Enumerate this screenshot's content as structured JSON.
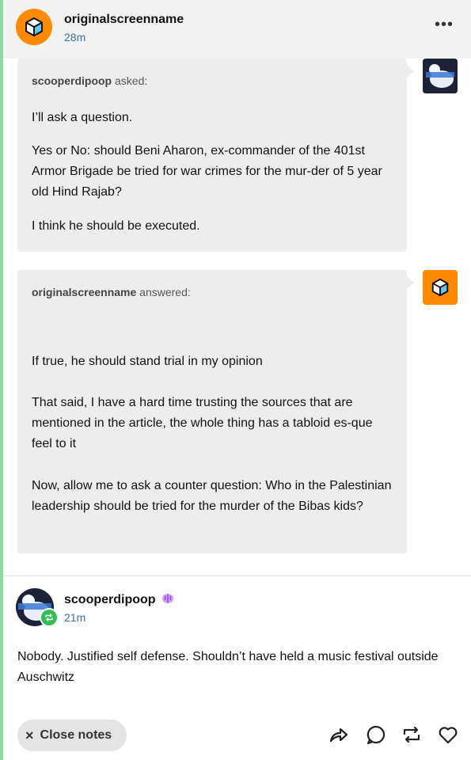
{
  "header": {
    "blog_name": "originalscreenname",
    "time": "28m",
    "more_menu": "•••"
  },
  "ask": {
    "asker": "scooperdipoop",
    "verb": " asked:",
    "paragraphs": [
      "I’ll ask a question.",
      "Yes or No: should Beni Aharon, ex-commander of the 401st Armor Brigade be tried for war crimes for the mur-der of 5 year old Hind Rajab?",
      "I think he should be executed."
    ]
  },
  "answer": {
    "answerer": "originalscreenname",
    "verb": " answered:",
    "paragraphs": [
      "If true, he should stand trial in my opinion",
      "That said, I have a hard time trusting the sources that are mentioned in the article, the whole thing has a tabloid es-que feel to it",
      "Now, allow me to ask a counter question: Who in the Palestinian leadership should be tried for the murder of the Bibas kids?"
    ]
  },
  "reply": {
    "blog_name": "scooperdipoop",
    "time": "21m",
    "text": "Nobody. Justified self defense. Shouldn’t have held a music festival outside Auschwitz"
  },
  "footer": {
    "close_notes": "Close notes",
    "close_icon": "×"
  },
  "colors": {
    "accent_orange": "#ff8a00",
    "link_blue": "#3a6fa0",
    "reblog_green": "#2fbf55",
    "rail_green": "#8fd9a0"
  },
  "icons": {
    "avatar": "cube-icon",
    "share": "share-icon",
    "reply": "reply-icon",
    "reblog": "reblog-icon",
    "like": "heart-icon"
  }
}
